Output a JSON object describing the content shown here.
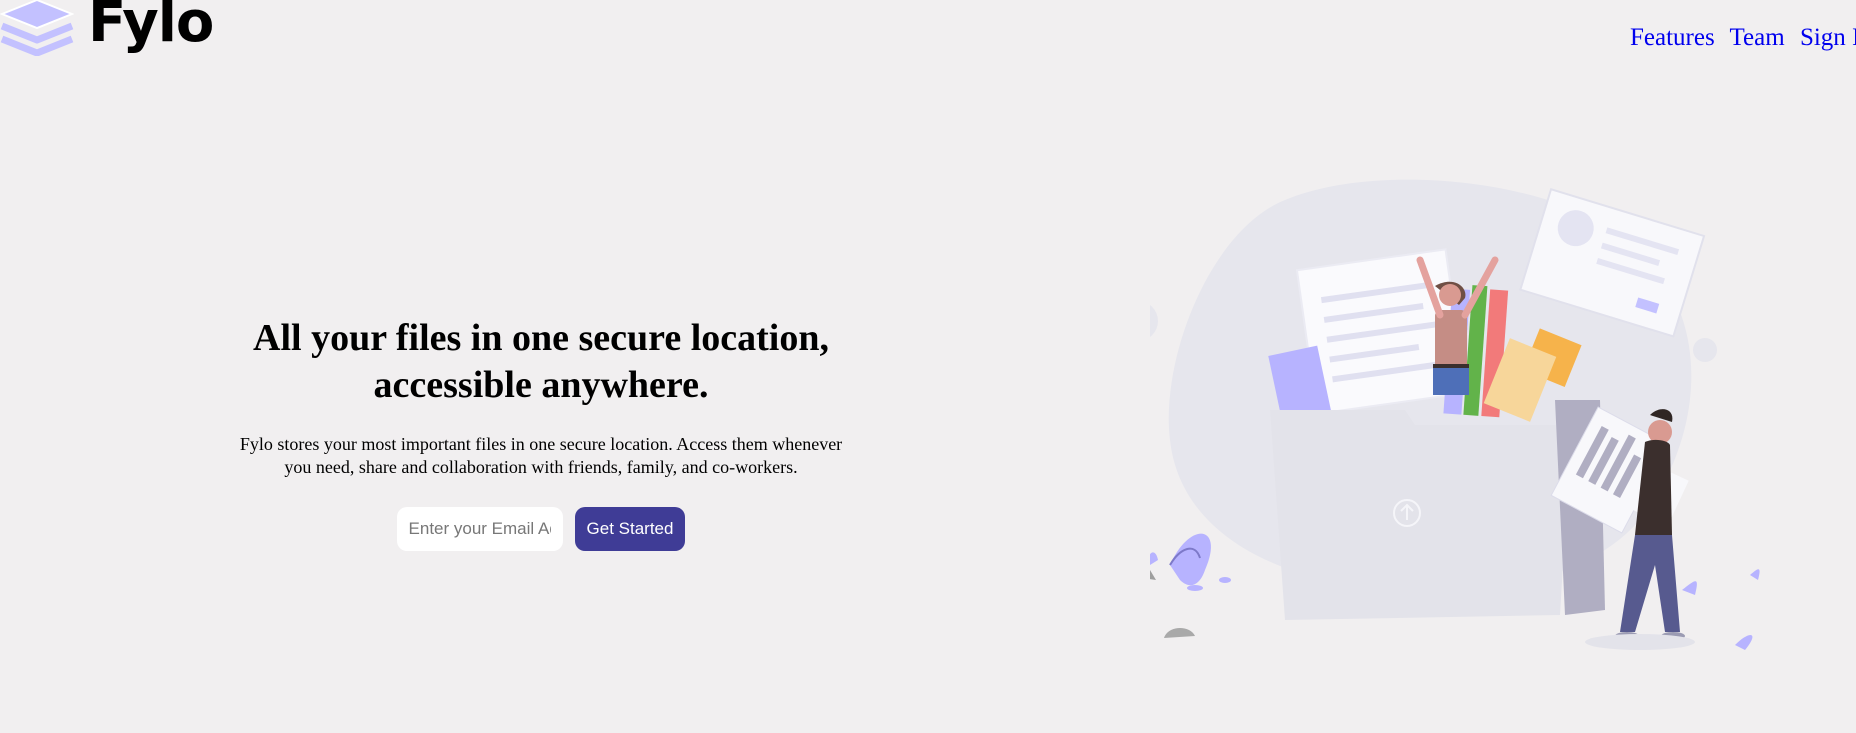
{
  "brand": {
    "name": "Fylo",
    "logo_icon": "layers-icon",
    "logo_color": "#c3c1ff"
  },
  "nav": {
    "items": [
      {
        "label": "Features"
      },
      {
        "label": "Team"
      },
      {
        "label": "Sign In"
      }
    ],
    "link_color": "#0000ee"
  },
  "hero": {
    "title_line1": "All your files in one secure location,",
    "title_line2": "accessible anywhere.",
    "description_line1": "Fylo stores your most important files in one secure location. Access them whenever",
    "description_line2": "you need, share and collaboration with friends, family, and co-workers.",
    "email_placeholder": "Enter your Email Address",
    "email_value": "",
    "cta_label": "Get Started"
  },
  "illustration": {
    "icon": "file-sharing-illustration",
    "upload_icon": "upload-arrow-icon"
  },
  "colors": {
    "background": "#f1eff0",
    "button": "#3f3c96",
    "accent_purple": "#b7b3ff",
    "blob": "#e6e6ed"
  }
}
